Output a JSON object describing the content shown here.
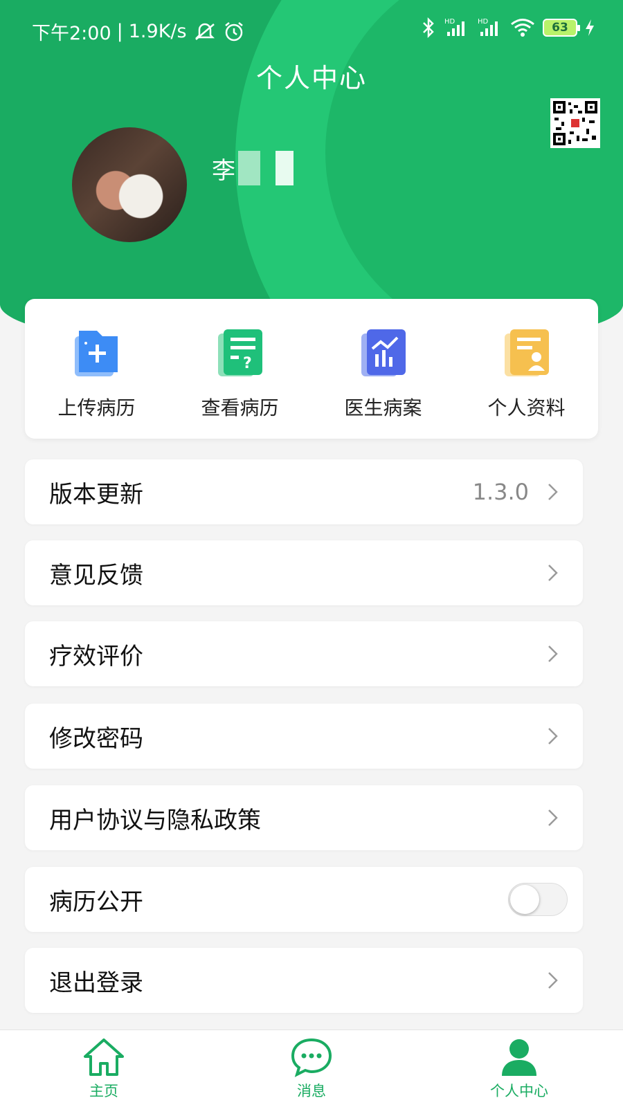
{
  "status_bar": {
    "time": "下午2:00",
    "separator": "|",
    "speed": "1.9K/s",
    "battery": "63",
    "signal_label": "HD"
  },
  "header": {
    "title": "个人中心",
    "username": "李"
  },
  "quick_actions": [
    {
      "label": "上传病历",
      "icon": "upload-record-icon",
      "color": "#3d8cf5"
    },
    {
      "label": "查看病历",
      "icon": "view-record-icon",
      "color": "#1fc07a"
    },
    {
      "label": "医生病案",
      "icon": "doctor-case-icon",
      "color": "#4f68e8"
    },
    {
      "label": "个人资料",
      "icon": "profile-doc-icon",
      "color": "#f6c04f"
    }
  ],
  "menu": [
    {
      "label": "版本更新",
      "value": "1.3.0"
    },
    {
      "label": "意见反馈"
    },
    {
      "label": "疗效评价"
    },
    {
      "label": "修改密码"
    },
    {
      "label": "用户协议与隐私政策"
    },
    {
      "label": "病历公开",
      "toggle": false
    },
    {
      "label": "退出登录"
    }
  ],
  "bottom_nav": [
    {
      "label": "主页",
      "icon": "home-icon"
    },
    {
      "label": "消息",
      "icon": "message-icon"
    },
    {
      "label": "个人中心",
      "icon": "user-icon",
      "active": true
    }
  ],
  "colors": {
    "brand_green": "#1aac62",
    "light_green": "#24c775"
  }
}
